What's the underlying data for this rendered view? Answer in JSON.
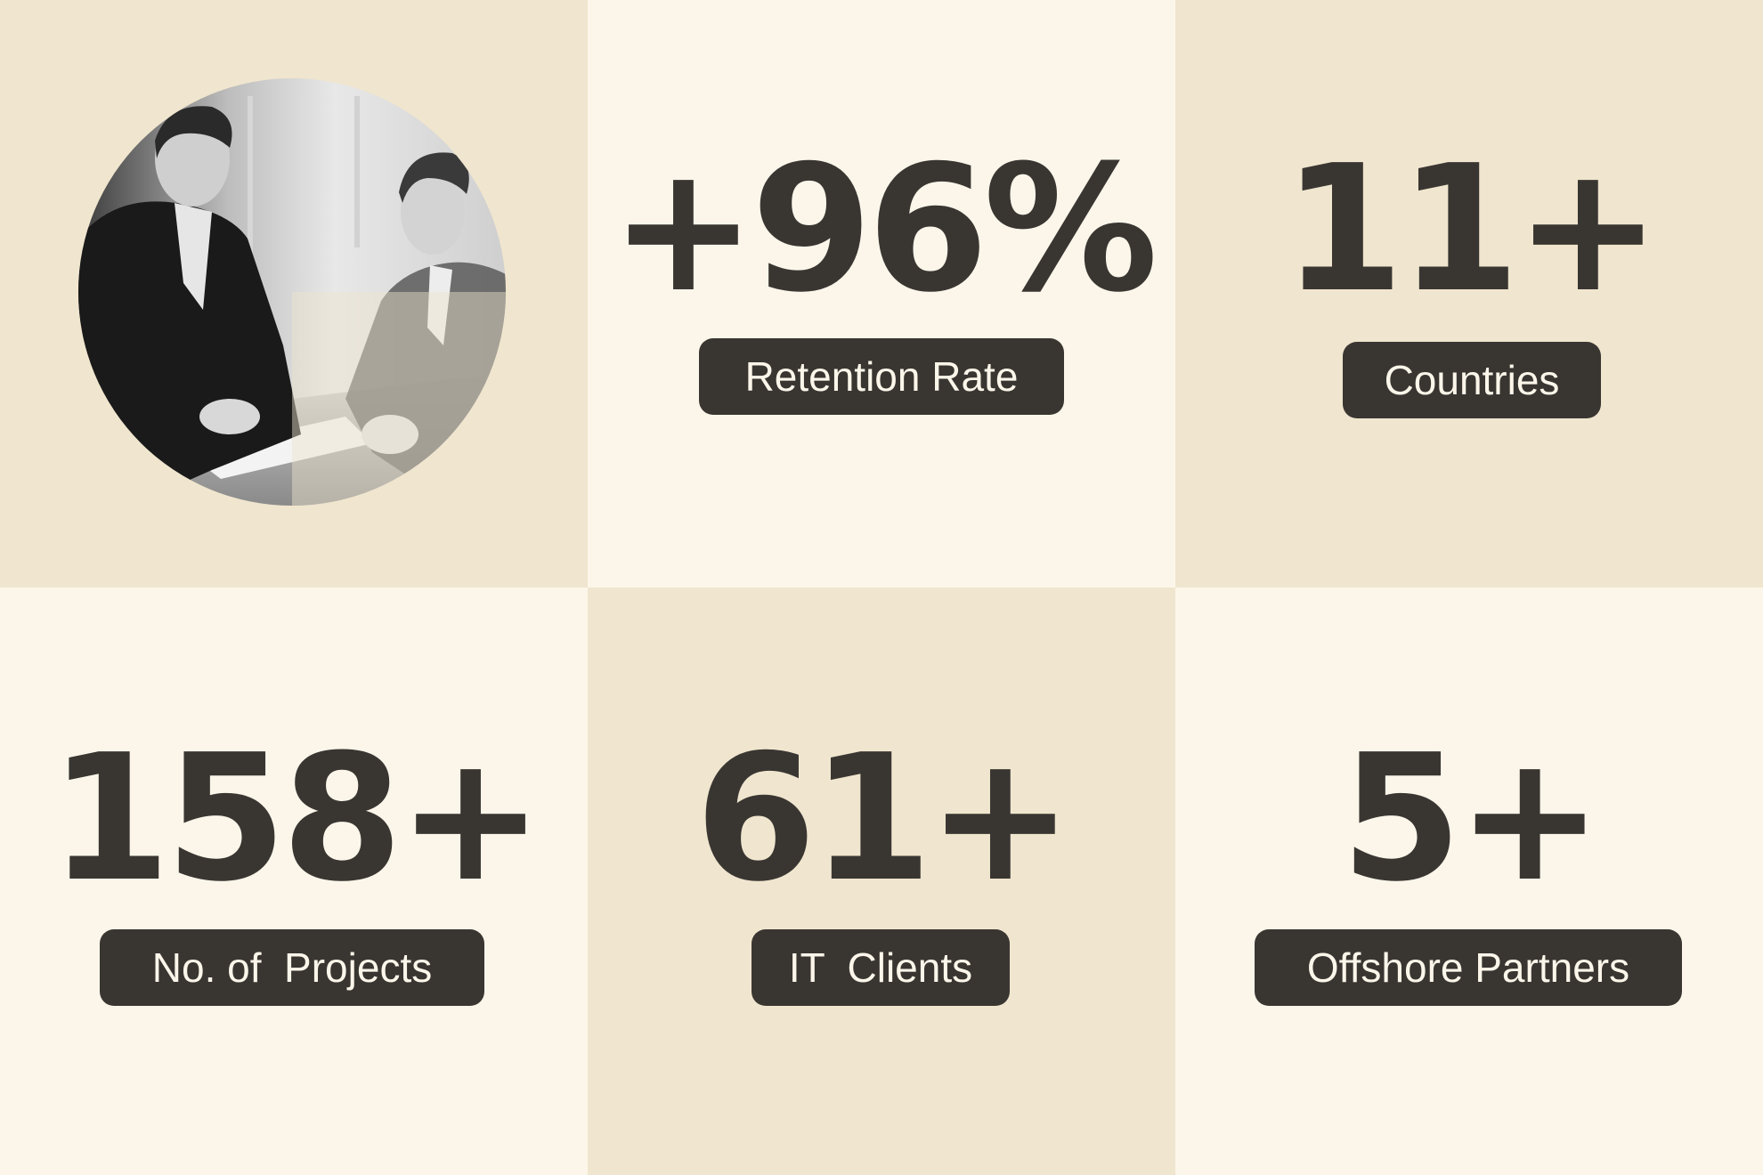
{
  "colors": {
    "tile_dark": "#F0E5CE",
    "tile_light": "#FCF6EA",
    "text_dark": "#393632",
    "pill_text": "#FCF6EA"
  },
  "photo": {
    "icon": "business-handshake-photo"
  },
  "stats": [
    {
      "value": "+96%",
      "label": "Retention Rate"
    },
    {
      "value": "11+",
      "label": "Countries"
    },
    {
      "value": "158+",
      "label": "No. of  Projects"
    },
    {
      "value": "61+",
      "label": "IT  Clients"
    },
    {
      "value": "5+",
      "label": "Offshore Partners"
    }
  ]
}
